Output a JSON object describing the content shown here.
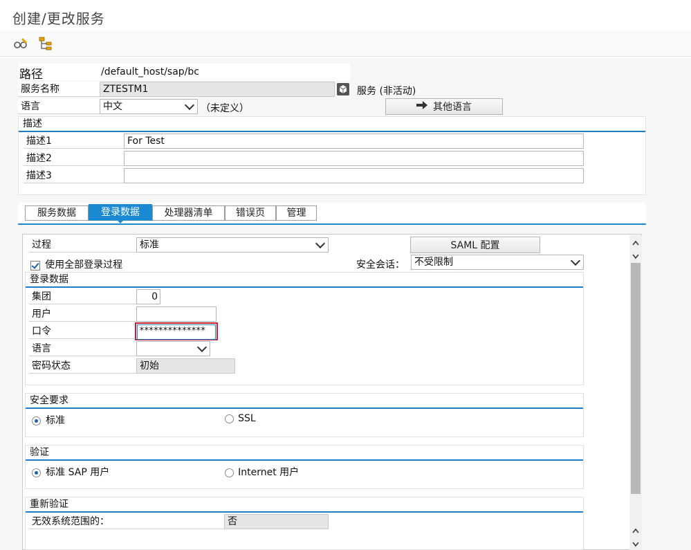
{
  "window": {
    "title": "创建/更改服务"
  },
  "toolbar": {
    "icons": [
      "display-change-icon",
      "hierarchy-icon"
    ]
  },
  "header": {
    "path_label": "路径",
    "path_value": "/default_host/sap/bc",
    "service_name_label": "服务名称",
    "service_name_value": "ZTESTM1",
    "service_status": "服务 (非活动)",
    "language_label": "语言",
    "language_value": "中文",
    "language_note": "（未定义）",
    "other_languages_button": "其他语言"
  },
  "description": {
    "title": "描述",
    "rows": [
      {
        "label": "描述1",
        "value": "For Test"
      },
      {
        "label": "描述2",
        "value": ""
      },
      {
        "label": "描述3",
        "value": ""
      }
    ]
  },
  "tabs": [
    {
      "label": "服务数据",
      "active": false
    },
    {
      "label": "登录数据",
      "active": true
    },
    {
      "label": "处理器清单",
      "active": false
    },
    {
      "label": "错误页",
      "active": false
    },
    {
      "label": "管理",
      "active": false
    }
  ],
  "logon": {
    "procedure_label": "过程",
    "procedure_value": "标准",
    "saml_button": "SAML 配置",
    "use_all_procedures_label": "使用全部登录过程",
    "security_session_label": "安全会话：",
    "security_session_value": "不受限制",
    "logon_data_title": "登录数据",
    "client_label": "集团",
    "client_value": "0",
    "user_label": "用户",
    "user_value": "",
    "password_label": "口令",
    "password_value": "**************",
    "language_label": "语言",
    "language_value": "",
    "password_status_label": "密码状态",
    "password_status_value": "初始"
  },
  "security": {
    "title": "安全要求",
    "option_standard": "标准",
    "option_ssl": "SSL"
  },
  "auth": {
    "title": "验证",
    "option_sap_user": "标准 SAP 用户",
    "option_internet_user": "Internet 用户"
  },
  "reauth": {
    "title": "重新验证",
    "system_wide_label": "无效系统范围的：",
    "system_wide_value": "否"
  },
  "colors": {
    "accent": "#1b8ad3",
    "group_line": "#1b7cc8"
  }
}
